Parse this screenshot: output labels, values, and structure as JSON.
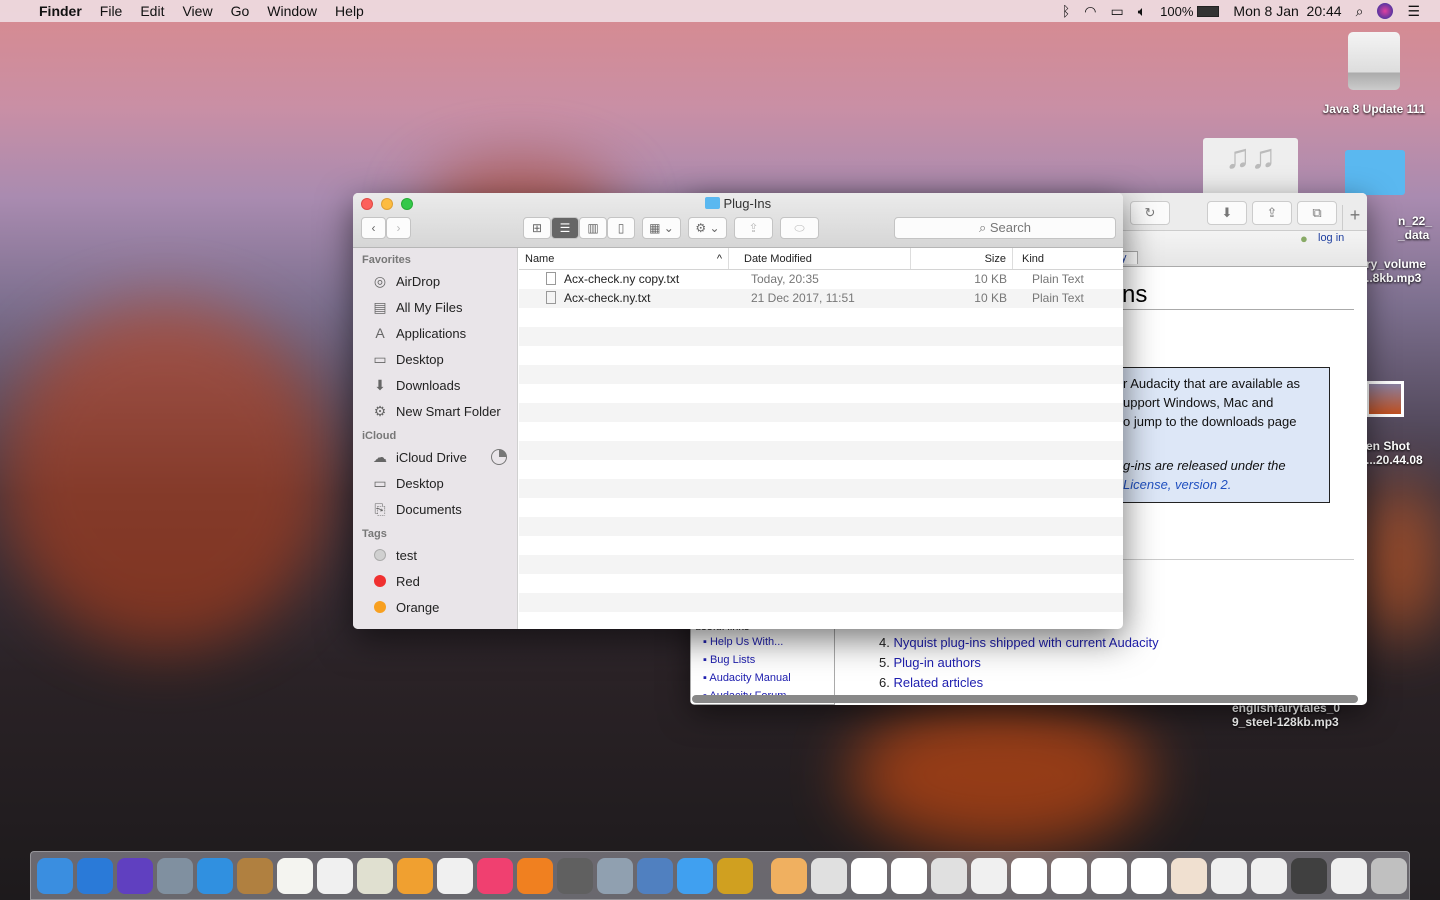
{
  "menubar": {
    "app": "Finder",
    "items": [
      "File",
      "Edit",
      "View",
      "Go",
      "Window",
      "Help"
    ],
    "battery": "100%",
    "datetime": "Mon 8 Jan  20:44"
  },
  "desktop": {
    "icons": [
      "Java 8 Update 111",
      "n_22_\n_data",
      "ry_volume\n..8kb.mp3",
      "en Shot\n...20.44.08",
      "englishfairytales_0\n9_steel-128kb.mp3"
    ]
  },
  "browser": {
    "login": "log in",
    "tab": "y",
    "heading": "ns",
    "box": [
      "r Audacity that are available as",
      "upport Windows, Mac and",
      "o jump to the downloads page",
      "g-ins are released under the",
      "License, version 2."
    ],
    "sidebar_title": "useful links",
    "links": [
      "Help Us With...",
      "Bug Lists",
      "Audacity Manual",
      "Audacity Forum"
    ],
    "toc": [
      {
        "n": "4.",
        "t": "Nyquist plug-ins shipped with current Audacity"
      },
      {
        "n": "5.",
        "t": "Plug-in authors"
      },
      {
        "n": "6.",
        "t": "Related articles"
      }
    ]
  },
  "finder": {
    "title": "Plug-Ins",
    "search_placeholder": "Search",
    "sections": [
      {
        "title": "Favorites",
        "items": [
          {
            "label": "AirDrop",
            "icon": "◎"
          },
          {
            "label": "All My Files",
            "icon": "▤"
          },
          {
            "label": "Applications",
            "icon": "A"
          },
          {
            "label": "Desktop",
            "icon": "▭"
          },
          {
            "label": "Downloads",
            "icon": "⬇"
          },
          {
            "label": "New Smart Folder",
            "icon": "⚙"
          }
        ]
      },
      {
        "title": "iCloud",
        "items": [
          {
            "label": "iCloud Drive",
            "icon": "☁"
          },
          {
            "label": "Desktop",
            "icon": "▭"
          },
          {
            "label": "Documents",
            "icon": "⎘"
          }
        ]
      }
    ],
    "tags_title": "Tags",
    "tags": [
      {
        "label": "test",
        "color": "#d0d0d0"
      },
      {
        "label": "Red",
        "color": "#f03030"
      },
      {
        "label": "Orange",
        "color": "#f8a020"
      }
    ],
    "columns": {
      "name": "Name",
      "date": "Date Modified",
      "size": "Size",
      "kind": "Kind"
    },
    "files": [
      {
        "name": "Acx-check.ny copy.txt",
        "date": "Today, 20:35",
        "size": "10 KB",
        "kind": "Plain Text"
      },
      {
        "name": "Acx-check.ny.txt",
        "date": "21 Dec 2017, 11:51",
        "size": "10 KB",
        "kind": "Plain Text"
      }
    ]
  },
  "dock": {
    "colors": [
      "#3a8ee0",
      "#2a7ad8",
      "#6040c0",
      "#8090a0",
      "#3090e0",
      "#b08040",
      "#f4f4f0",
      "#f0f0f0",
      "#e0e0d0",
      "#f0a030",
      "#f0f0f0",
      "#f04070",
      "#f08020",
      "#606060",
      "#90a0b0",
      "#5080c0",
      "#40a0f0",
      "#d0a020",
      "#f0b060",
      "#e0e0e0",
      "#ffffff",
      "#ffffff",
      "#e0e0e0",
      "#f0f0f0",
      "#ffffff",
      "#ffffff",
      "#ffffff",
      "#ffffff",
      "#f0e0d0",
      "#f0f0f0",
      "#f0f0f0",
      "#404040",
      "#f0f0f0",
      "#c0c0c0"
    ]
  }
}
